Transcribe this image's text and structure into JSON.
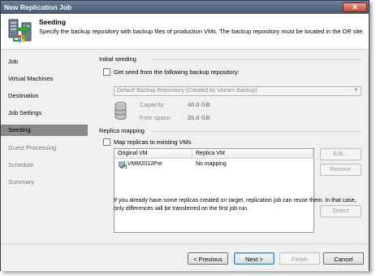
{
  "window": {
    "title": "New Replication Job"
  },
  "header": {
    "title": "Seeding",
    "description": "Specify the backup repository with backup files of production VMs. The backup repository must be located in the DR site."
  },
  "nav": {
    "items": [
      {
        "label": "Job",
        "state": "done"
      },
      {
        "label": "Virtual Machines",
        "state": "done"
      },
      {
        "label": "Destination",
        "state": "done"
      },
      {
        "label": "Job Settings",
        "state": "done"
      },
      {
        "label": "Seeding",
        "state": "active"
      },
      {
        "label": "Guest Processing",
        "state": "future"
      },
      {
        "label": "Schedule",
        "state": "future"
      },
      {
        "label": "Summary",
        "state": "future"
      }
    ]
  },
  "initial_seeding": {
    "section_label": "Initial seeding",
    "checkbox_label": "Get seed from the following backup repository:",
    "checked": false,
    "repository": "Default Backup Repository (Created by Veeam Backup)",
    "capacity_label": "Capacity:",
    "capacity_value": "40.0 GB",
    "free_label": "Free space:",
    "free_value": "25.8 GB"
  },
  "replica_mapping": {
    "section_label": "Replica mapping",
    "checkbox_label": "Map replicas to existing VMs",
    "checked": false,
    "columns": [
      "Original VM",
      "Replica VM"
    ],
    "rows": [
      {
        "original": "VMM2012Pre",
        "replica": "No mapping"
      }
    ],
    "buttons": {
      "edit": "Edit...",
      "remove": "Remove",
      "detect": "Detect"
    },
    "note": "If you already have some replicas created on target, replication job can reuse them. In that case, only differences will be transferred on the first job run."
  },
  "footer": {
    "previous": "< Previous",
    "next": "Next >",
    "finish": "Finish",
    "cancel": "Cancel"
  }
}
